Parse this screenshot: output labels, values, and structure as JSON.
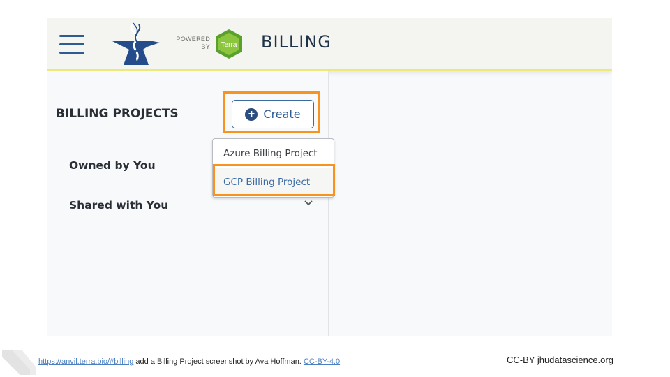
{
  "header": {
    "menu_icon": "hamburger-icon",
    "logo_icon": "anvil-dna-logo",
    "powered_line1": "POWERED",
    "powered_line2": "BY",
    "terra_label": "Terra",
    "title": "BILLING"
  },
  "sidebar": {
    "heading": "BILLING PROJECTS",
    "create_button": {
      "icon": "plus-circle-icon",
      "label": "Create"
    },
    "create_menu": [
      {
        "label": "Azure Billing Project",
        "highlighted": false
      },
      {
        "label": "GCP Billing Project",
        "highlighted": true
      }
    ],
    "sections": [
      {
        "label": "Owned by You"
      },
      {
        "label": "Shared with You",
        "icon": "chevron-down-icon"
      }
    ]
  },
  "colors": {
    "highlight": "#f7931e",
    "accent": "#2e5b94",
    "header_border": "#ece87a"
  },
  "footer": {
    "link": "https://anvil.terra.bio/#billing",
    "caption_text": " add a Billing Project screenshot by Ava Hoffman.  ",
    "license_link": "CC-BY-4.0",
    "credit": "CC-BY  jhudatascience.org"
  }
}
